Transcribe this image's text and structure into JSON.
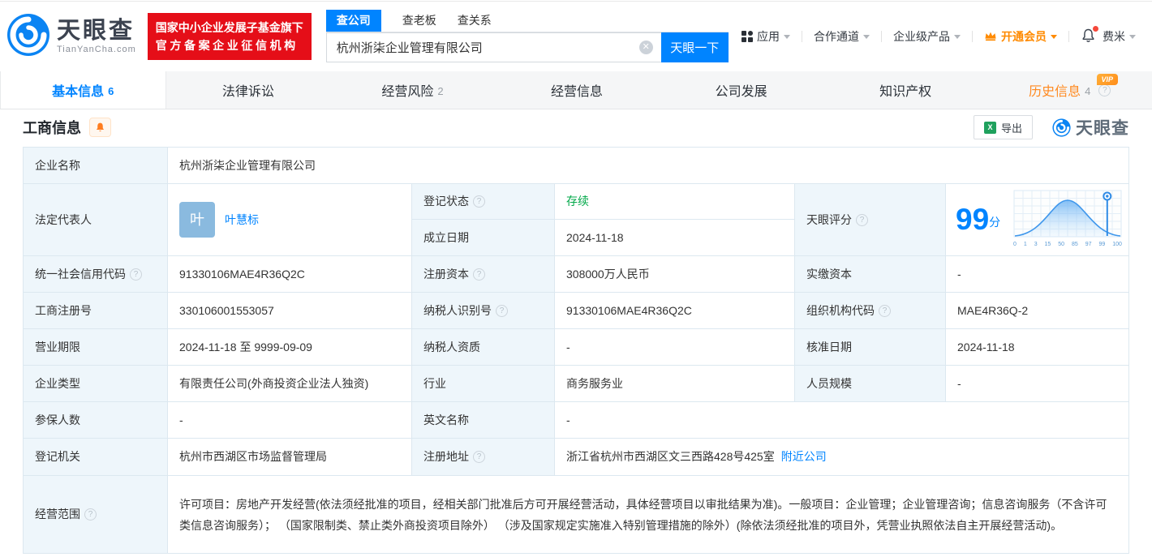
{
  "header": {
    "logo": {
      "title": "天眼查",
      "domain": "TianYanCha.com"
    },
    "badge": {
      "line1": "国家中小企业发展子基金旗下",
      "line2": "官方备案企业征信机构"
    },
    "search": {
      "tab_company": "查公司",
      "tab_boss": "查老板",
      "tab_relation": "查关系",
      "value": "杭州浙柒企业管理有限公司",
      "button": "天眼一下"
    },
    "nav": {
      "apps": "应用",
      "partners": "合作通道",
      "enterprise": "企业级产品",
      "vip": "开通会员",
      "user": "费米"
    }
  },
  "tabbar": {
    "tabs": [
      {
        "label": "基本信息",
        "count": "6"
      },
      {
        "label": "法律诉讼",
        "count": ""
      },
      {
        "label": "经营风险",
        "count": "2"
      },
      {
        "label": "经营信息",
        "count": ""
      },
      {
        "label": "公司发展",
        "count": ""
      },
      {
        "label": "知识产权",
        "count": ""
      },
      {
        "label": "历史信息",
        "count": "4"
      }
    ],
    "vip_badge": "VIP"
  },
  "section": {
    "title": "工商信息",
    "export_label": "导出",
    "watermark": "天眼查"
  },
  "score": {
    "label": "天眼评分",
    "value": "99",
    "unit": "分",
    "axis": [
      "0",
      "1",
      "3",
      "15",
      "50",
      "85",
      "97",
      "99",
      "100"
    ]
  },
  "table": {
    "company_name": {
      "label": "企业名称",
      "value": "杭州浙柒企业管理有限公司"
    },
    "legal_rep": {
      "label": "法定代表人",
      "avatar": "叶",
      "name": "叶慧标"
    },
    "reg_status": {
      "label": "登记状态",
      "value": "存续"
    },
    "establish_date": {
      "label": "成立日期",
      "value": "2024-11-18"
    },
    "credit_code": {
      "label": "统一社会信用代码",
      "value": "91330106MAE4R36Q2C"
    },
    "reg_capital": {
      "label": "注册资本",
      "value": "308000万人民币"
    },
    "paid_capital": {
      "label": "实缴资本",
      "value": "-"
    },
    "reg_number": {
      "label": "工商注册号",
      "value": "330106001553057"
    },
    "taxpayer_id": {
      "label": "纳税人识别号",
      "value": "91330106MAE4R36Q2C"
    },
    "org_code": {
      "label": "组织机构代码",
      "value": "MAE4R36Q-2"
    },
    "business_term": {
      "label": "营业期限",
      "value": "2024-11-18 至 9999-09-09"
    },
    "taxpayer_quality": {
      "label": "纳税人资质",
      "value": "-"
    },
    "approval_date": {
      "label": "核准日期",
      "value": "2024-11-18"
    },
    "company_type": {
      "label": "企业类型",
      "value": "有限责任公司(外商投资企业法人独资)"
    },
    "industry": {
      "label": "行业",
      "value": "商务服务业"
    },
    "staff_size": {
      "label": "人员规模",
      "value": "-"
    },
    "insured_count": {
      "label": "参保人数",
      "value": "-"
    },
    "english_name": {
      "label": "英文名称",
      "value": "-"
    },
    "reg_authority": {
      "label": "登记机关",
      "value": "杭州市西湖区市场监督管理局"
    },
    "reg_address": {
      "label": "注册地址",
      "value": "浙江省杭州市西湖区文三西路428号425室",
      "link": "附近公司"
    },
    "business_scope": {
      "label": "经营范围",
      "value": "许可项目：房地产开发经营(依法须经批准的项目，经相关部门批准后方可开展经营活动，具体经营项目以审批结果为准)。一般项目：企业管理；企业管理咨询；信息咨询服务（不含许可类信息咨询服务）； （国家限制类、禁止类外商投资项目除外） （涉及国家规定实施准入特别管理措施的除外）(除依法须经批准的项目外，凭营业执照依法自主开展经营活动)。"
    }
  }
}
